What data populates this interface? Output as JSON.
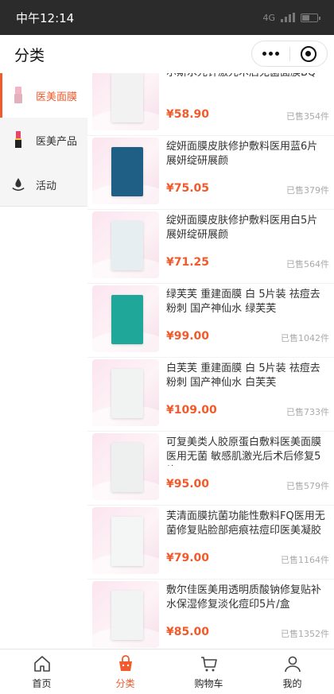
{
  "status_bar": {
    "time": "中午12:14",
    "network": "4G",
    "battery_level": 0.5
  },
  "header": {
    "title": "分类"
  },
  "sidebar": {
    "items": [
      {
        "label": "医美面膜",
        "icon": "lipstick-icon",
        "active": true
      },
      {
        "label": "医美产品",
        "icon": "lipstick-tube-icon",
        "active": false
      },
      {
        "label": "活动",
        "icon": "water-drop-icon",
        "active": false
      }
    ]
  },
  "products": [
    {
      "title": "尔斯水光针激光术后无菌面膜BQ",
      "price": "¥58.90",
      "sold": "已售354件",
      "pack_color": "#f2f2f2"
    },
    {
      "title": "绽妍面膜皮肤修护敷料医用蓝6片 展妍绽研展颜",
      "price": "¥75.05",
      "sold": "已售379件",
      "pack_color": "#1f5f86"
    },
    {
      "title": "绽妍面膜皮肤修护敷料医用白5片 展妍绽研展颜",
      "price": "¥71.25",
      "sold": "已售564件",
      "pack_color": "#e6eef2"
    },
    {
      "title": "绿芙芙 重建面膜 白 5片装 祛痘去粉刺 国产神仙水 绿芙芙",
      "price": "¥99.00",
      "sold": "已售1042件",
      "pack_color": "#1fa79a"
    },
    {
      "title": "白芙芙 重建面膜 白 5片装 祛痘去粉刺 国产神仙水 白芙芙",
      "price": "¥109.00",
      "sold": "已售733件",
      "pack_color": "#f1f3f2"
    },
    {
      "title": "可复美类人胶原蛋白敷料医美面膜医用无菌 敏感肌激光后术后修复5片...",
      "price": "¥95.00",
      "sold": "已售579件",
      "pack_color": "#eef0f0"
    },
    {
      "title": "芙清面膜抗菌功能性敷料FQ医用无菌修复贴脸部疤痕祛痘印医美凝胶5...",
      "price": "¥79.00",
      "sold": "已售1164件",
      "pack_color": "#f4f6f6"
    },
    {
      "title": "敷尔佳医美用透明质酸钠修复贴补水保湿修复淡化痘印5片/盒",
      "price": "¥85.00",
      "sold": "已售1352件",
      "pack_color": "#f2f4f4"
    }
  ],
  "tabbar": [
    {
      "label": "首页",
      "icon": "home-icon",
      "active": false
    },
    {
      "label": "分类",
      "icon": "shopping-bag-icon",
      "active": true
    },
    {
      "label": "购物车",
      "icon": "cart-icon",
      "active": false
    },
    {
      "label": "我的",
      "icon": "user-icon",
      "active": false
    }
  ]
}
